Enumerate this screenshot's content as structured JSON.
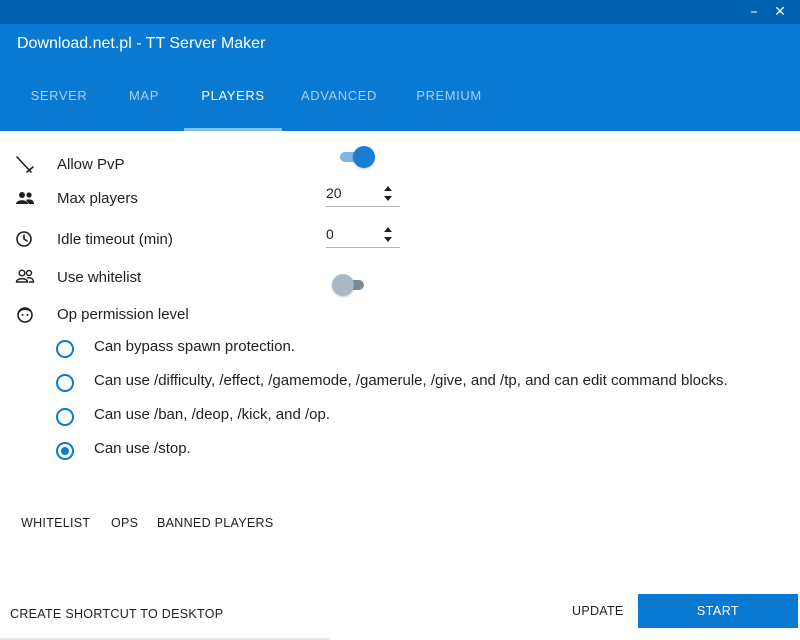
{
  "window": {
    "title": "Download.net.pl - TT Server Maker",
    "minimize_glyph": "–",
    "close_glyph": "✕"
  },
  "tabs": [
    {
      "label": "SERVER",
      "active": false
    },
    {
      "label": "MAP",
      "active": false
    },
    {
      "label": "PLAYERS",
      "active": true
    },
    {
      "label": "ADVANCED",
      "active": false
    },
    {
      "label": "PREMIUM",
      "active": false
    }
  ],
  "settings": {
    "allow_pvp": {
      "label": "Allow PvP",
      "icon": "sword-icon",
      "on": true
    },
    "max_players": {
      "label": "Max players",
      "icon": "people-icon",
      "value": "20"
    },
    "idle_timeout": {
      "label": "Idle timeout (min)",
      "icon": "clock-icon",
      "value": "0"
    },
    "use_whitelist": {
      "label": "Use whitelist",
      "icon": "people-outline-icon",
      "on": false
    },
    "op_permission": {
      "label": "Op permission level",
      "icon": "face-icon",
      "options": [
        {
          "label": "Can bypass spawn protection.",
          "selected": false
        },
        {
          "label": "Can use /difficulty, /effect, /gamemode, /gamerule, /give, and /tp, and can edit command blocks.",
          "selected": false
        },
        {
          "label": "Can use /ban, /deop, /kick, and /op.",
          "selected": false
        },
        {
          "label": "Can use /stop.",
          "selected": true
        }
      ]
    }
  },
  "sub_tabs": [
    "WHITELIST",
    "OPS",
    "BANNED PLAYERS"
  ],
  "footer": {
    "shortcut_label": "CREATE SHORTCUT TO DESKTOP",
    "update_label": "UPDATE",
    "start_label": "START"
  },
  "colors": {
    "titlebar": "#0063b1",
    "header": "#0a79d1",
    "accent": "#0a79d1",
    "toggle_on": "#1a7dd4"
  }
}
